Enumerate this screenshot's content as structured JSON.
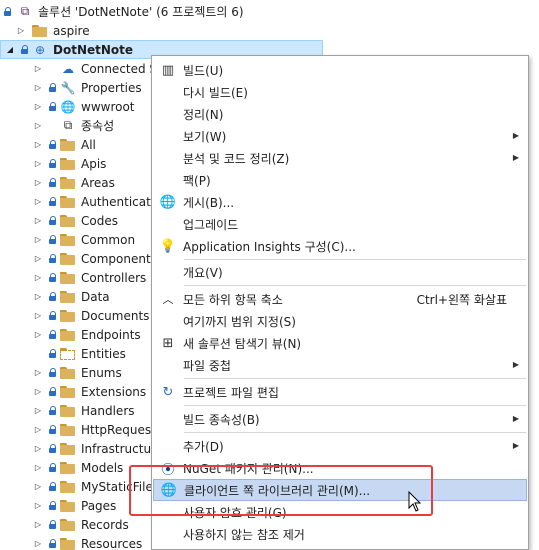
{
  "tree": {
    "solution_label": "솔루션 'DotNetNote'  (6 프로젝트의 6)",
    "aspire": "aspire",
    "project": "DotNetNote",
    "items": [
      "Connected Se",
      "Properties",
      "wwwroot",
      "종속성",
      "All",
      "Apis",
      "Areas",
      "Authenticatio",
      "Codes",
      "Common",
      "Components",
      "Controllers",
      "Data",
      "Documents",
      "Endpoints",
      "Entities",
      "Enums",
      "Extensions",
      "Handlers",
      "HttpRequests",
      "Infrastructures",
      "Models",
      "MyStaticFiles",
      "Pages",
      "Records",
      "Resources"
    ]
  },
  "menu": {
    "build": "빌드(U)",
    "rebuild": "다시 빌드(E)",
    "clean": "정리(N)",
    "view": "보기(W)",
    "analyze": "분석 및 코드 정리(Z)",
    "pack": "팩(P)",
    "publish": "게시(B)...",
    "upgrade": "업그레이드",
    "app_insights": "Application Insights 구성(C)...",
    "overview": "개요(V)",
    "collapse": "모든 하위 항목 축소",
    "collapse_shortcut": "Ctrl+왼쪽 화살표",
    "scope": "여기까지 범위 지정(S)",
    "new_view": "새 솔루션 탐색기 뷰(N)",
    "file_nesting": "파일 중첩",
    "edit_project": "프로젝트 파일 편집",
    "build_deps": "빌드 종속성(B)",
    "add": "추가(D)",
    "nuget": "NuGet 패키지 관리(N)...",
    "client_libs": "클라이언트 쪽 라이브러리 관리(M)...",
    "user_secrets": "사용자 암호 관리(G)",
    "remove_unused": "사용하지 않는 참조 제거"
  },
  "colors": {
    "highlight": "#c7d8f2",
    "annotation": "#e2403a",
    "selection": "#cce8ff"
  }
}
